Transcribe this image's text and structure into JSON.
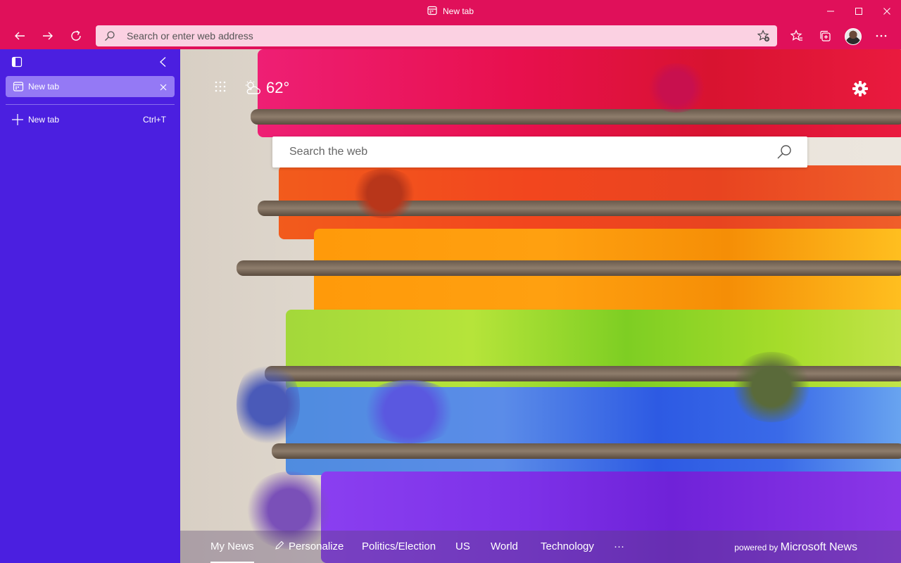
{
  "window": {
    "title": "New tab"
  },
  "toolbar": {
    "address_placeholder": "Search or enter web address"
  },
  "sidebar": {
    "active_tab_label": "New tab",
    "new_tab_label": "New tab",
    "new_tab_shortcut": "Ctrl+T"
  },
  "newtab": {
    "temperature": "62°",
    "search_placeholder": "Search the web",
    "nav": {
      "my_news": "My News",
      "personalize": "Personalize",
      "politics": "Politics/Election",
      "us": "US",
      "world": "World",
      "technology": "Technology",
      "more": "···"
    },
    "powered_prefix": "powered by",
    "powered_brand": "Microsoft News"
  },
  "colors": {
    "title_bar": "#e0105a",
    "address_bar": "#fbd1e2",
    "sidebar": "#4b1fe0",
    "active_tab": "#9479f5"
  }
}
